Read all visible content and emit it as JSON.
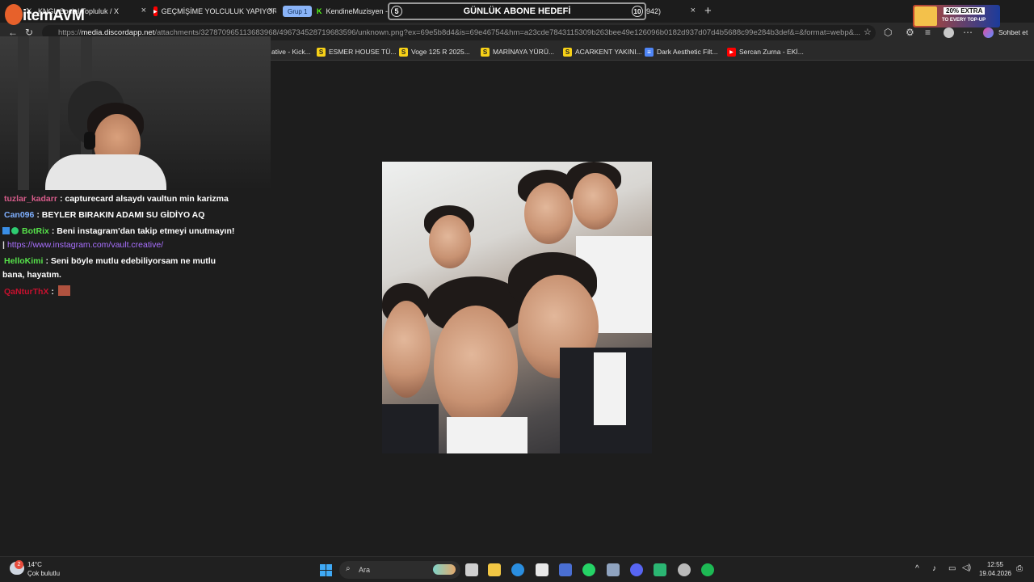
{
  "tabs": [
    {
      "label": "KNGL Social Topluluk / X",
      "icon": "x-icon"
    },
    {
      "label": "GEÇMİŞİME YOLCULUK YAPIYORUM",
      "icon": "youtube-icon"
    },
    {
      "label": "KendineMuzisyen - V",
      "icon": "kick-icon"
    },
    {
      "label": "unknown.png (5…942)",
      "icon": "globe-icon"
    }
  ],
  "tab_group_label": "Grup 1",
  "address_bar": {
    "url_prefix": "https://",
    "url_host": "media.discordapp.net",
    "url_rest": "/attachments/327870965113683968/496734528719683596/unknown.png?ex=69e5b8d4&is=69e46754&hm=a23cde7843115309b263bee49e126096b0182d937d07d4b5688c99e284b3def&=&format=webp&..."
  },
  "chat_sidebar_label": "Sohbet et",
  "bookmarks": [
    {
      "label": "ative - Kick...",
      "icon": "kick-icon"
    },
    {
      "label": "ESMER HOUSE TÜ...",
      "icon": "s-icon"
    },
    {
      "label": "Voge 125 R 2025...",
      "icon": "s-icon"
    },
    {
      "label": "MARİNAYA YÜRÜ...",
      "icon": "s-icon"
    },
    {
      "label": "ACARKENT YAKINI...",
      "icon": "s-icon"
    },
    {
      "label": "Dark Aesthetic Filt...",
      "icon": "doc-icon"
    },
    {
      "label": "Sercan Zurna - EKİ...",
      "icon": "youtube-icon"
    }
  ],
  "stream_overlay": {
    "brand": "itemAVM",
    "goal_label": "GÜNLÜK ABONE HEDEFİ",
    "goal_current": "5",
    "goal_target": "10",
    "promo_line1": "20% EXTRA",
    "promo_line2": "TO EVERY TOP-UP"
  },
  "chat": [
    {
      "user": "tuzlar_kadarr",
      "color": "#d65c8a",
      "message": ": capturecard alsaydı vaultun min karizma"
    },
    {
      "user": "Can096",
      "color": "#7fb0ff",
      "message": ": BEYLER BIRAKIN ADAMI SU GİDİYO AQ"
    },
    {
      "user": "BotRix",
      "color": "#57e34b",
      "message": ": Beni instagram'dan takip etmeyi unutmayın!",
      "link": "https://www.instagram.com/vault.creative/"
    },
    {
      "user": "HelloKimi",
      "color": "#57e34b",
      "message": ": Seni böyle mutlu edebiliyorsam ne mutlu",
      "message_cont": "bana, hayatım."
    },
    {
      "user": "QaNturThX",
      "color": "#c8102e",
      "message": ":"
    }
  ],
  "taskbar": {
    "weather_temp": "14°C",
    "weather_desc": "Çok bulutlu",
    "search_placeholder": "Ara",
    "time": "12:55",
    "date": "19.04.2026",
    "notification_count": "2"
  }
}
